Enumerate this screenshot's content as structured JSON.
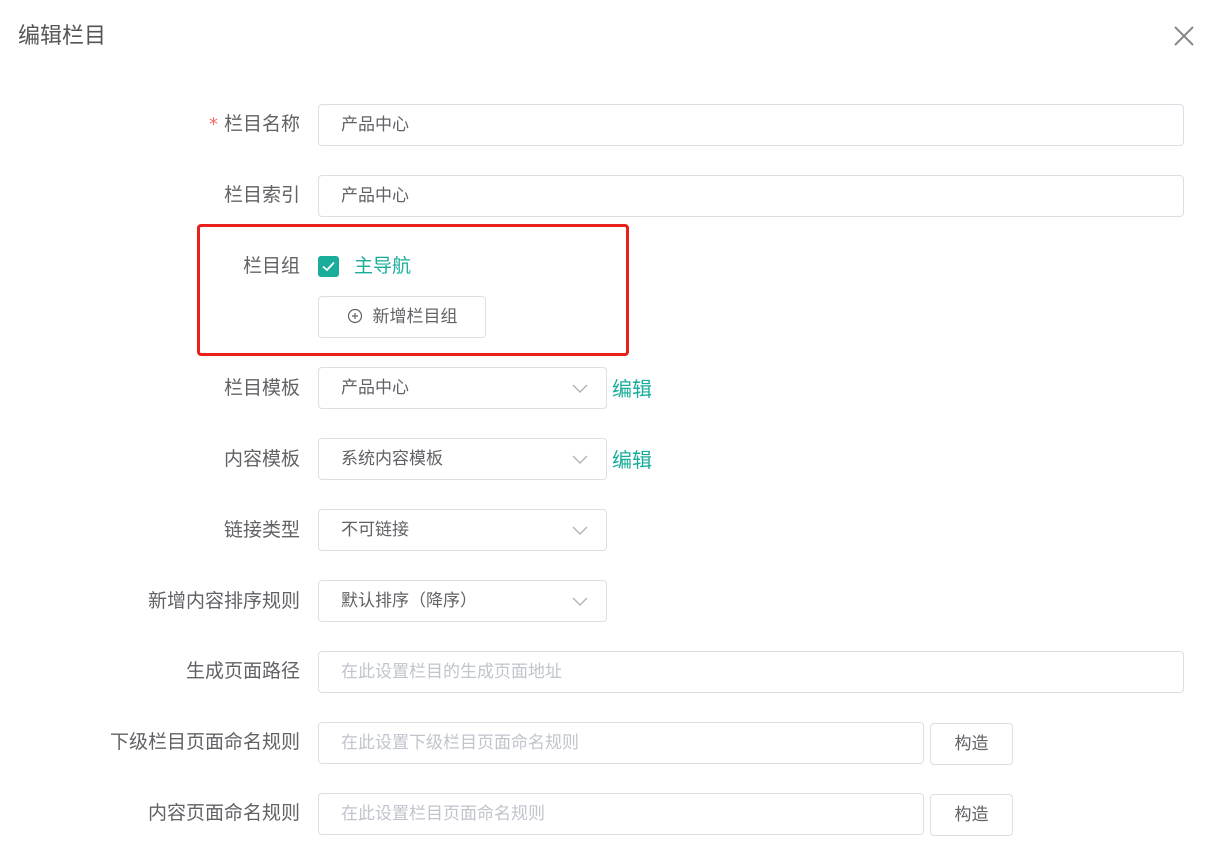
{
  "dialog": {
    "title": "编辑栏目"
  },
  "fields": {
    "name": {
      "required_mark": "*",
      "label": "栏目名称",
      "value": "产品中心"
    },
    "index": {
      "label": "栏目索引",
      "value": "产品中心"
    },
    "group": {
      "label": "栏目组",
      "checkbox_label": "主导航",
      "checked": true,
      "add_button": "新增栏目组"
    },
    "column_template": {
      "label": "栏目模板",
      "value": "产品中心",
      "edit_link": "编辑"
    },
    "content_template": {
      "label": "内容模板",
      "value": "系统内容模板",
      "edit_link": "编辑"
    },
    "link_type": {
      "label": "链接类型",
      "value": "不可链接"
    },
    "sort_rule": {
      "label": "新增内容排序规则",
      "value": "默认排序（降序）"
    },
    "page_path": {
      "label": "生成页面路径",
      "placeholder": "在此设置栏目的生成页面地址"
    },
    "child_naming": {
      "label": "下级栏目页面命名规则",
      "placeholder": "在此设置下级栏目页面命名规则",
      "button": "构造"
    },
    "content_naming": {
      "label": "内容页面命名规则",
      "placeholder": "在此设置栏目页面命名规则",
      "button": "构造"
    }
  },
  "colors": {
    "accent": "#1aad9b",
    "required": "#f56c6c",
    "highlight_border": "#e8211c"
  },
  "icons": {
    "close": "close-icon",
    "plus_circle": "plus-circle-icon",
    "chevron": "chevron-down-icon",
    "check": "check-icon"
  }
}
